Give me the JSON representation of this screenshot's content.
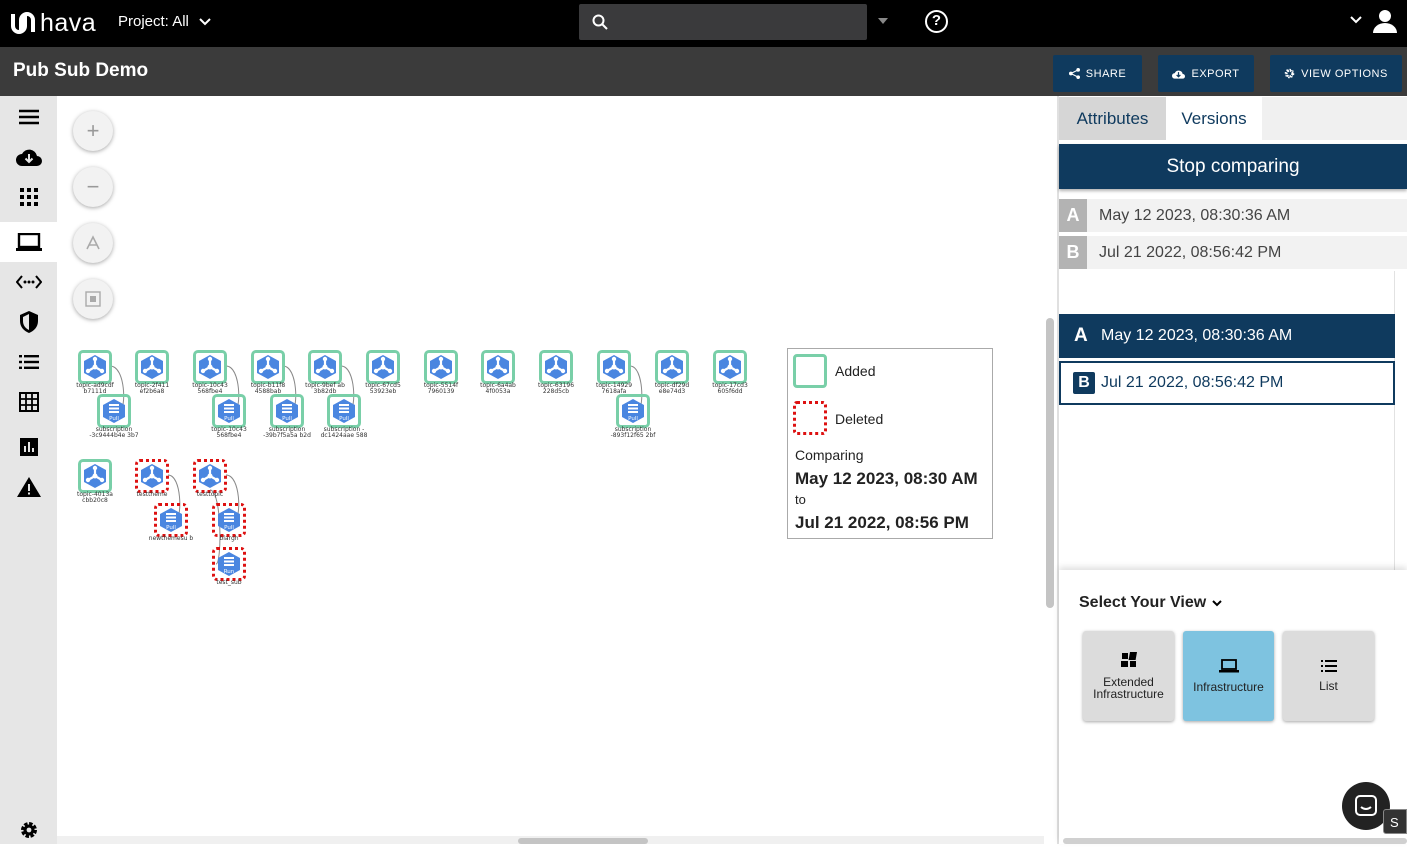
{
  "header": {
    "logo_text": "hava",
    "project_label": "Project: All",
    "search_placeholder": ""
  },
  "titlebar": {
    "title": "Pub Sub Demo",
    "share_label": "SHARE",
    "export_label": "EXPORT",
    "view_options_label": "VIEW OPTIONS"
  },
  "sidebar": {
    "items": [
      "menu-icon",
      "cloud-download-icon",
      "grid-icon",
      "laptop-icon",
      "connections-icon",
      "shield-icon",
      "list-icon",
      "table-icon",
      "chart-icon",
      "warning-icon"
    ],
    "active": "laptop-icon",
    "settings": "gear-icon"
  },
  "canvas": {
    "zoom_in": "+",
    "zoom_out": "−",
    "topics_row1": [
      "topic-ad9cdf b7111d",
      "topic-2f411 ef2b6a8",
      "topic-10c43 568fbe4",
      "topic-b11f8 4588bab",
      "topic-9bef ab 3b82db",
      "topic-67cd5 53923eb",
      "topic-5514f 7960139",
      "topic-6a4ab 4f0053a",
      "topic-63196 228d5cb",
      "topic-14929 7618afa",
      "topic-df29d e8e74d3",
      "topic-17cd3 605f6dd"
    ],
    "subs_row1": [
      "subscription -3c9444b4e 3b7",
      "topic-10c43 568fbe4",
      "subscription -39b7f5a5a b2d",
      "subscription -dc1424aae 588",
      "subscription -893f12f65 2bf"
    ],
    "topics_row2": [
      "topic-4013a cbb20c8",
      "testtheme",
      "testtopic"
    ],
    "subs_row2": [
      "newthemesu b",
      "blargh",
      "test_sub"
    ],
    "pull_label": "Pull",
    "run_label": "Run"
  },
  "legend": {
    "added_label": "Added",
    "deleted_label": "Deleted",
    "comparing_label": "Comparing",
    "from_date": "May 12 2023, 08:30 AM",
    "to_label": "to",
    "to_date": "Jul 21 2022, 08:56 PM",
    "added_color": "#79cfa8",
    "deleted_color": "#dd1111"
  },
  "panel": {
    "tabs": [
      "Attributes",
      "Versions"
    ],
    "active_tab": "Versions",
    "stop_label": "Stop comparing",
    "version_a_letter": "A",
    "version_a": "May 12 2023, 08:30:36 AM",
    "version_b_letter": "B",
    "version_b": "Jul 21 2022, 08:56:42 PM",
    "select_view_label": "Select Your View",
    "views": [
      "Extended Infrastructure",
      "Infrastructure",
      "List"
    ],
    "active_view": "Infrastructure",
    "s_tab": "S"
  },
  "colors": {
    "navy": "#0f3a5e",
    "active_view": "#7ec3e0"
  }
}
